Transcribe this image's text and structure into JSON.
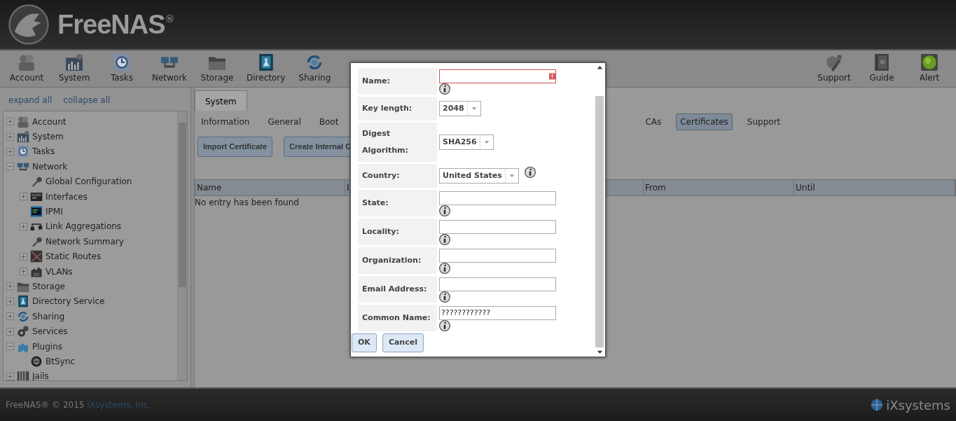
{
  "header": {
    "logo_text": "FreeNAS",
    "registered": "®"
  },
  "toolbar": {
    "left": [
      "Account",
      "System",
      "Tasks",
      "Network",
      "Storage",
      "Directory",
      "Sharing"
    ],
    "right": [
      "Support",
      "Guide",
      "Alert"
    ]
  },
  "sidebar": {
    "links": [
      "expand all",
      "collapse all"
    ],
    "tree": [
      {
        "label": "Account",
        "expanded": false
      },
      {
        "label": "System",
        "expanded": false
      },
      {
        "label": "Tasks",
        "expanded": false
      },
      {
        "label": "Network",
        "expanded": true,
        "children": [
          {
            "label": "Global Configuration"
          },
          {
            "label": "Interfaces",
            "expanded": false
          },
          {
            "label": "IPMI"
          },
          {
            "label": "Link Aggregations",
            "expanded": false
          },
          {
            "label": "Network Summary"
          },
          {
            "label": "Static Routes",
            "expanded": false
          },
          {
            "label": "VLANs",
            "expanded": false
          }
        ]
      },
      {
        "label": "Storage",
        "expanded": false
      },
      {
        "label": "Directory Service",
        "expanded": false
      },
      {
        "label": "Sharing",
        "expanded": false
      },
      {
        "label": "Services",
        "expanded": false
      },
      {
        "label": "Plugins",
        "expanded": true,
        "children": [
          {
            "label": "BtSync"
          }
        ]
      },
      {
        "label": "Jails",
        "expanded": false
      }
    ]
  },
  "main": {
    "tabs": [
      {
        "label": "System",
        "selected": true
      }
    ],
    "subtabs": [
      {
        "label": "Information",
        "selected": false
      },
      {
        "label": "General",
        "selected": false
      },
      {
        "label": "Boot",
        "selected": false
      },
      {
        "label": "CAs",
        "selected": false
      },
      {
        "label": "Certificates",
        "selected": true
      },
      {
        "label": "Support",
        "selected": false
      }
    ],
    "buttons": [
      "Import Certificate",
      "Create Internal C"
    ],
    "table": {
      "columns": [
        "Name",
        "I",
        "From",
        "Until"
      ],
      "empty_message": "No entry has been found"
    }
  },
  "dialog": {
    "fields": [
      {
        "label": "Name:",
        "kind": "text",
        "error": true,
        "info": true
      },
      {
        "label": "Key length:",
        "kind": "select",
        "value": "2048",
        "info": false
      },
      {
        "label": "Digest Algorithm:",
        "kind": "select",
        "value": "SHA256",
        "info": false
      },
      {
        "label": "Country:",
        "kind": "select",
        "value": "United States",
        "info": true
      },
      {
        "label": "State:",
        "kind": "text",
        "error": false,
        "info": true
      },
      {
        "label": "Locality:",
        "kind": "text",
        "error": false,
        "info": true
      },
      {
        "label": "Organization:",
        "kind": "text",
        "error": false,
        "info": true
      },
      {
        "label": "Email Address:",
        "kind": "text",
        "error": false,
        "info": true
      },
      {
        "label": "Common Name:",
        "kind": "text",
        "value": "????????????",
        "error": false,
        "info": true
      }
    ],
    "buttons": [
      "OK",
      "Cancel"
    ]
  },
  "footer": {
    "copyright": "FreeNAS® © 2015",
    "link": "iXsystems, Inc.",
    "logo_text": "iXsystems"
  }
}
